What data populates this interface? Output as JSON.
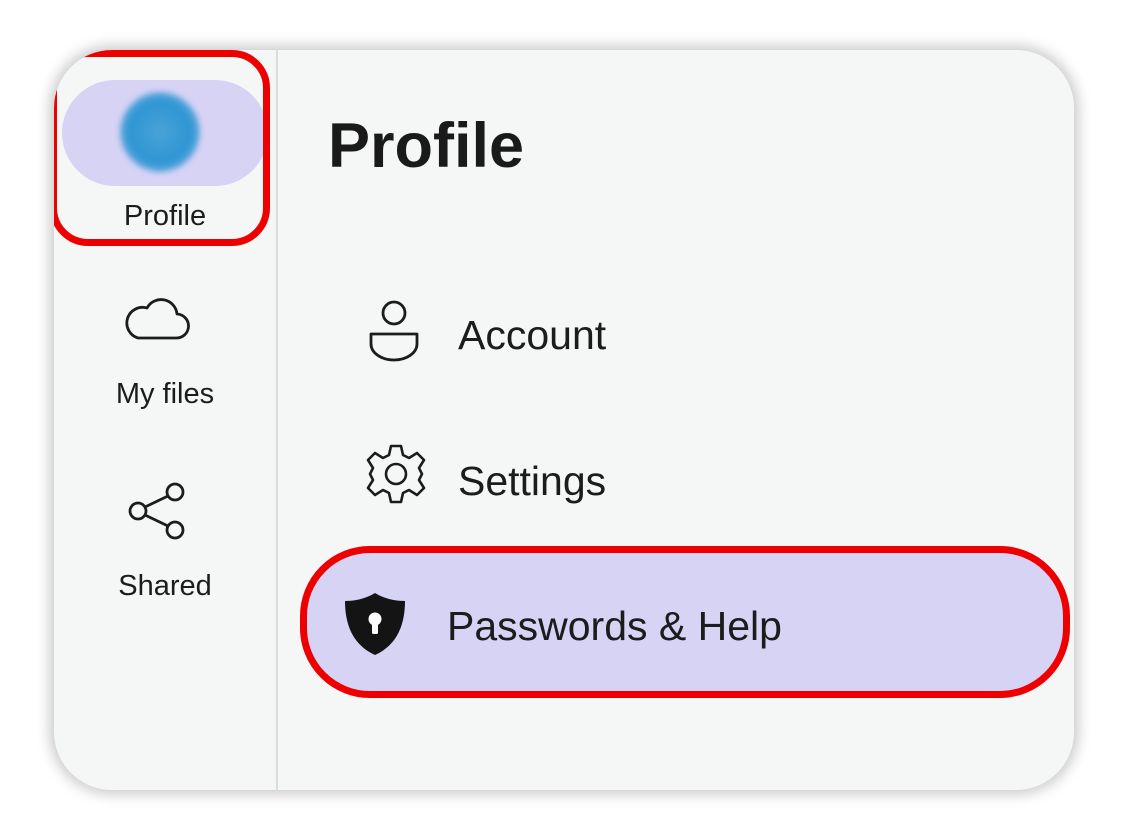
{
  "sidebar": {
    "items": [
      {
        "id": "profile",
        "label": "Profile",
        "icon": "avatar",
        "active": true
      },
      {
        "id": "my-files",
        "label": "My files",
        "icon": "cloud-icon",
        "active": false
      },
      {
        "id": "shared",
        "label": "Shared",
        "icon": "share-icon",
        "active": false
      }
    ]
  },
  "main": {
    "title": "Profile",
    "menu": [
      {
        "label": "Account",
        "icon": "user-icon",
        "active": false
      },
      {
        "label": "Settings",
        "icon": "gear-icon",
        "active": false
      },
      {
        "label": "Passwords & Help",
        "icon": "shield-keyhole-icon",
        "active": true
      }
    ]
  },
  "colors": {
    "active_background": "#d6d3f5",
    "highlight_outline": "#ee0000",
    "avatar": "#2d95d2",
    "surface": "#f5f7f6"
  }
}
